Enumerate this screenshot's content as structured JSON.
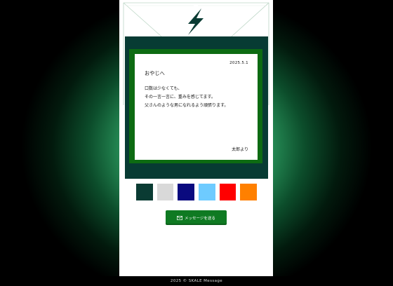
{
  "card": {
    "date": "2025.5.1",
    "greeting": "おやじへ",
    "lines": [
      "口数は少なくても、",
      "その一言一言に、重みを感じてます。",
      "父さんのような男になれるよう頑張ります。"
    ],
    "signature": "太郎より"
  },
  "swatches": [
    {
      "name": "dark-green",
      "color": "#0a3b33"
    },
    {
      "name": "light-gray",
      "color": "#d9d9d9"
    },
    {
      "name": "navy",
      "color": "#0a0a7f"
    },
    {
      "name": "sky-blue",
      "color": "#6ecbff"
    },
    {
      "name": "red",
      "color": "#ff0000"
    },
    {
      "name": "orange",
      "color": "#ff8000"
    }
  ],
  "send_button": {
    "label": "メッセージを送る",
    "icon": "mail-icon"
  },
  "logo": {
    "icon": "lightning-bolt-icon",
    "color": "#0a3b33"
  },
  "footer": {
    "text": "2025 © SKALE Message"
  }
}
